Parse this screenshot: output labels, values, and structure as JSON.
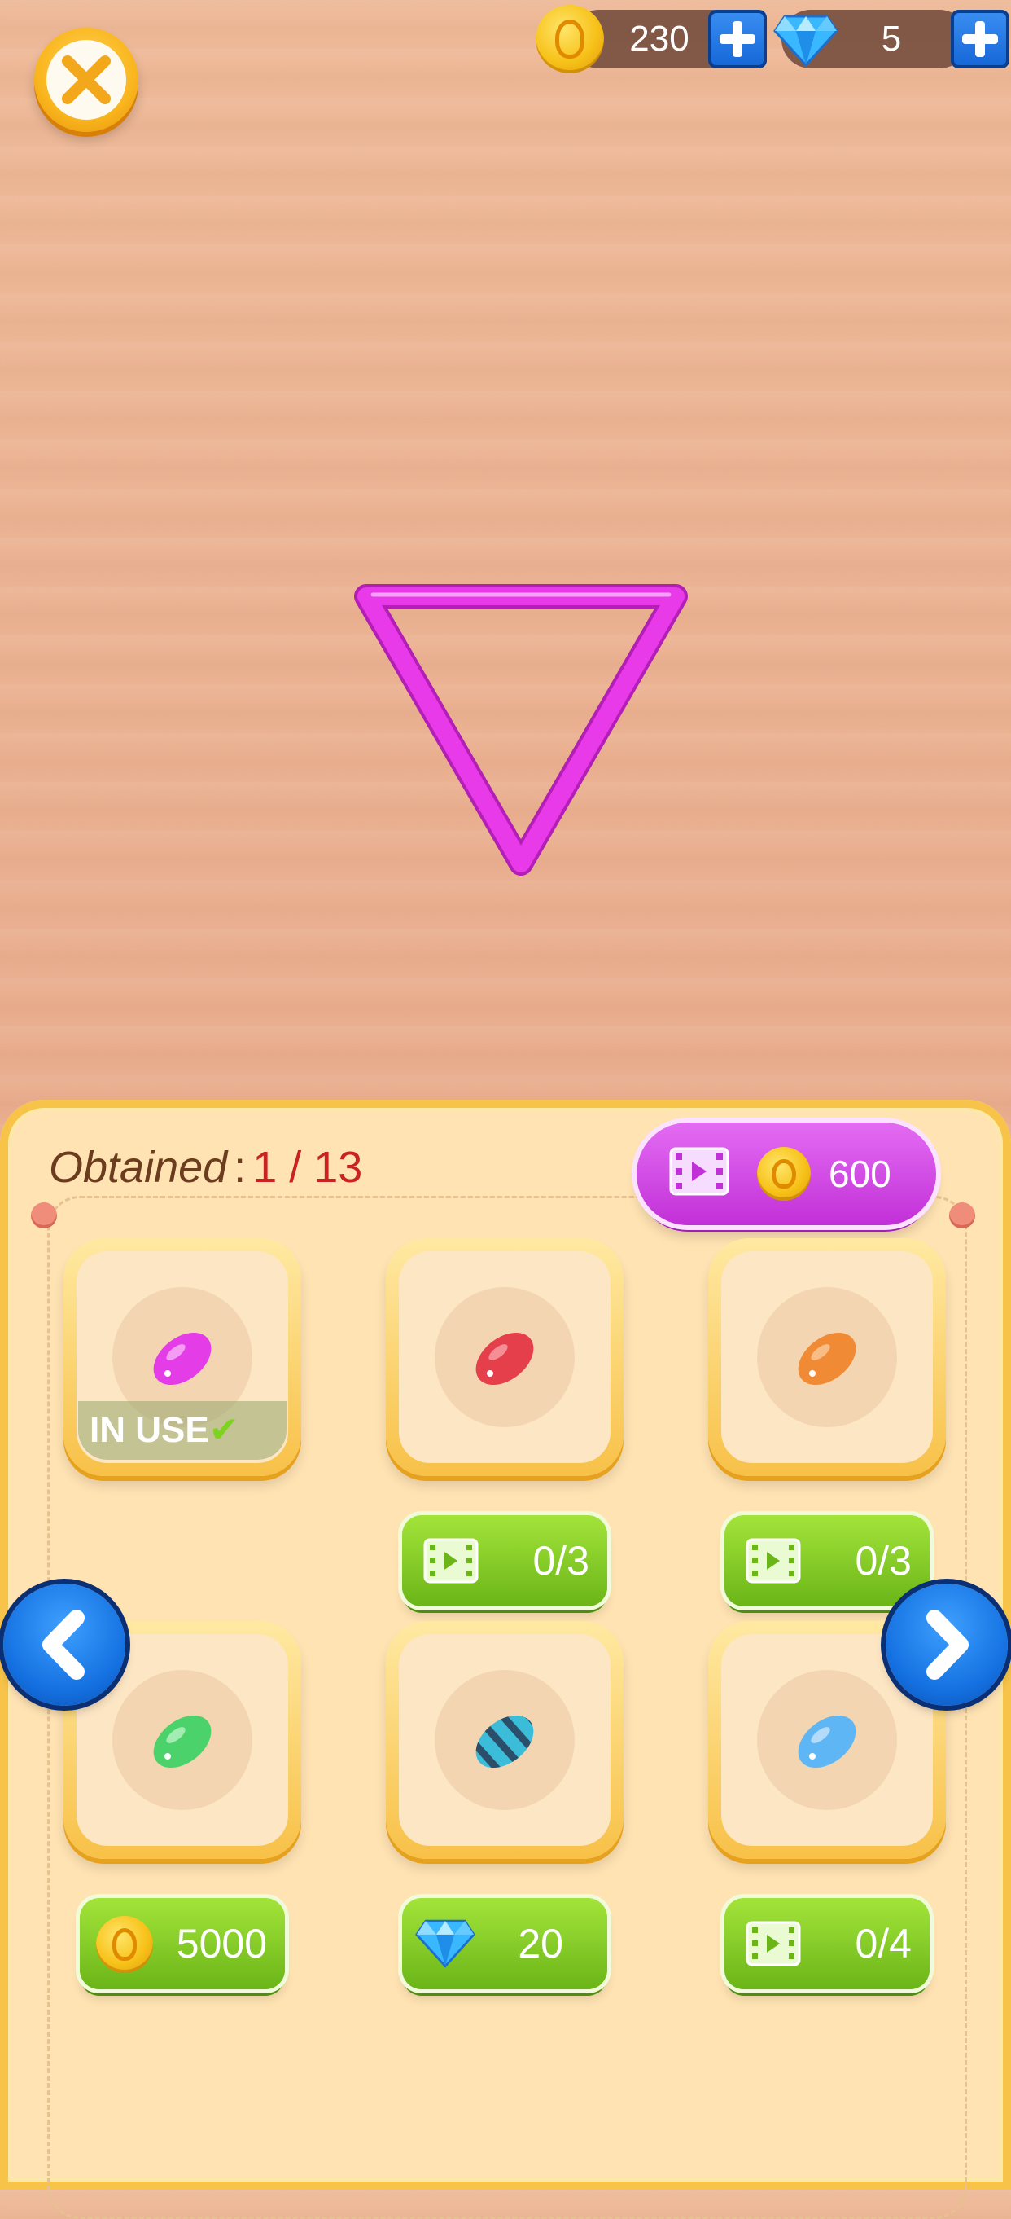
{
  "hud": {
    "coins": "230",
    "gems": "5",
    "coin_icon": "coin-icon",
    "gem_icon": "diamond-icon"
  },
  "shape": {
    "type": "triangle",
    "color": "#e83ae8"
  },
  "panel": {
    "obtained_label": "Obtained",
    "obtained_sep": ":",
    "obtained_count": "1  / 13",
    "ad_coin_amount": "600"
  },
  "skins": [
    {
      "color": "#e43ce6",
      "status": "IN USE",
      "cost_type": "none",
      "cost": ""
    },
    {
      "color": "#e43f4a",
      "status": "",
      "cost_type": "video",
      "cost": "0/3"
    },
    {
      "color": "#f08a34",
      "status": "",
      "cost_type": "video",
      "cost": "0/3"
    },
    {
      "color": "#4cd26a",
      "status": "",
      "cost_type": "coin",
      "cost": "5000"
    },
    {
      "color": "#3bbcd8",
      "status": "",
      "cost_type": "gem",
      "cost": "20"
    },
    {
      "color": "#5fb6f5",
      "status": "",
      "cost_type": "video",
      "cost": "0/4"
    }
  ],
  "colors": {
    "panel_bg": "#ffe3b3",
    "panel_border": "#f7c348",
    "purple_button": "#c230d8",
    "green_button": "#6bb518",
    "blue_arrow": "#1470e0"
  }
}
